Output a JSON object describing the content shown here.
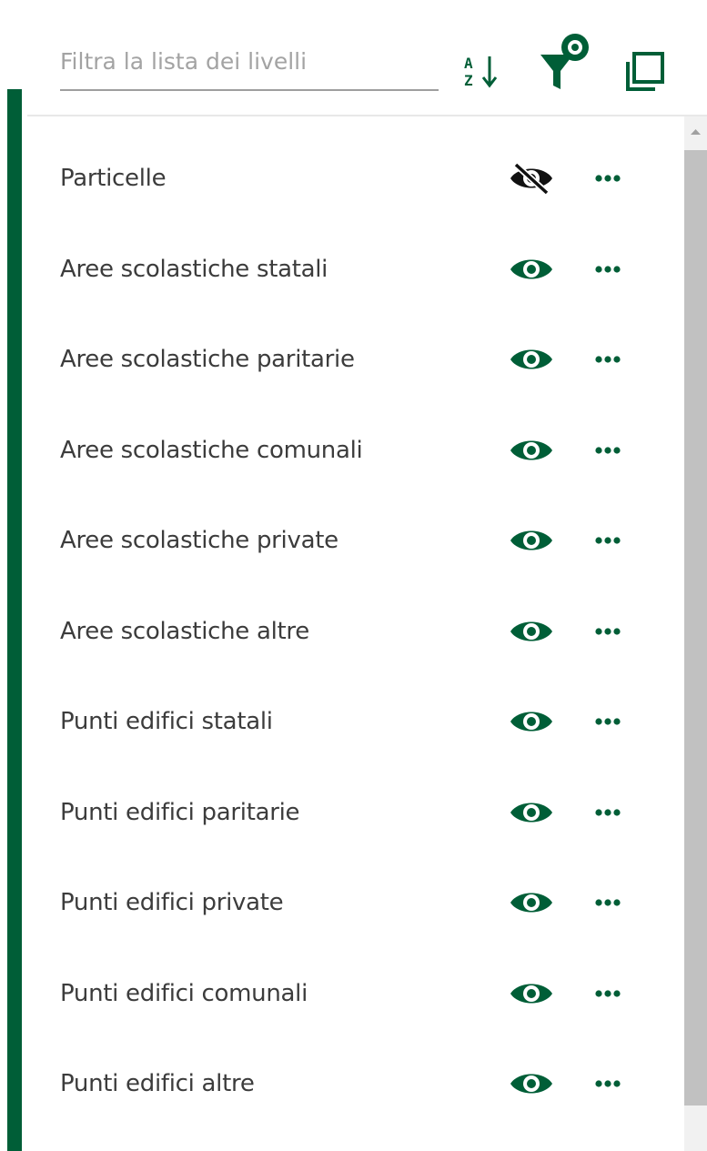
{
  "filter": {
    "placeholder": "Filtra la lista dei livelli"
  },
  "toolbar": {
    "sort_icon": "sort-az-icon",
    "filter_visible_icon": "filter-visible-icon",
    "collapse_icon": "copy-layers-icon"
  },
  "colors": {
    "accent": "#005e37",
    "hidden_icon": "#111111"
  },
  "layers": [
    {
      "label": "Particelle",
      "visible": false
    },
    {
      "label": "Aree scolastiche statali",
      "visible": true
    },
    {
      "label": "Aree scolastiche paritarie",
      "visible": true
    },
    {
      "label": "Aree scolastiche comunali",
      "visible": true
    },
    {
      "label": "Aree scolastiche private",
      "visible": true
    },
    {
      "label": "Aree scolastiche altre",
      "visible": true
    },
    {
      "label": "Punti edifici statali",
      "visible": true
    },
    {
      "label": "Punti edifici paritarie",
      "visible": true
    },
    {
      "label": "Punti edifici private",
      "visible": true
    },
    {
      "label": "Punti edifici comunali",
      "visible": true
    },
    {
      "label": "Punti edifici altre",
      "visible": true
    }
  ]
}
